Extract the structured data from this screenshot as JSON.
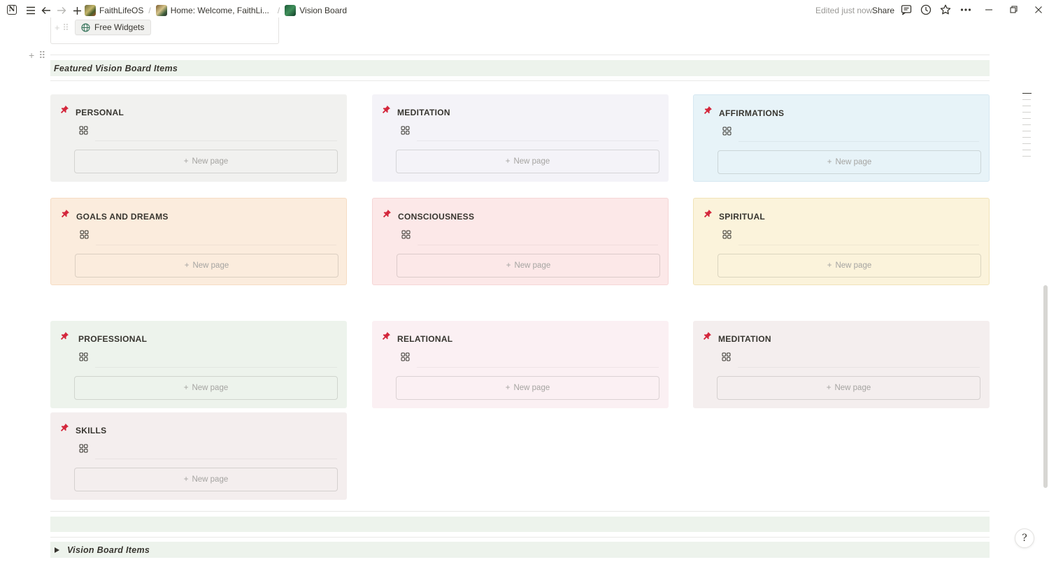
{
  "topbar": {
    "breadcrumbs": [
      {
        "label": "FaithLifeOS",
        "icon": "workspace-image-icon"
      },
      {
        "label": "Home: Welcome, FaithLi...",
        "icon": "page-image-icon"
      },
      {
        "label": "Vision Board",
        "icon": "page-image-icon"
      }
    ],
    "edited": "Edited just now",
    "share": "Share"
  },
  "widget": {
    "label": "Free Widgets"
  },
  "featured": {
    "title": "Featured Vision Board Items"
  },
  "cards": [
    {
      "title": "PERSONAL",
      "new_page": "New page",
      "color": "#f1f1ef"
    },
    {
      "title": "MEDITATION",
      "new_page": "New page",
      "color": "#f4f3f8"
    },
    {
      "title": "AFFIRMATIONS",
      "new_page": "New page",
      "color": "#e7f3f8"
    },
    {
      "title": "GOALS AND DREAMS",
      "new_page": "New page",
      "color": "#fbecdd"
    },
    {
      "title": "CONSCIOUSNESS",
      "new_page": "New page",
      "color": "#fce8e8"
    },
    {
      "title": "SPIRITUAL",
      "new_page": "New page",
      "color": "#fbf3db"
    },
    {
      "title": "PROFESSIONAL",
      "new_page": "New page",
      "color": "#edf3ec"
    },
    {
      "title": "RELATIONAL",
      "new_page": "New page",
      "color": "#fbf0f3"
    },
    {
      "title": "MEDITATION",
      "new_page": "New page",
      "color": "#f4eeee"
    },
    {
      "title": "SKILLS",
      "new_page": "New page",
      "color": "#f4eeee"
    }
  ],
  "toggle": {
    "label": "Vision Board Items"
  },
  "help": {
    "label": "?"
  }
}
